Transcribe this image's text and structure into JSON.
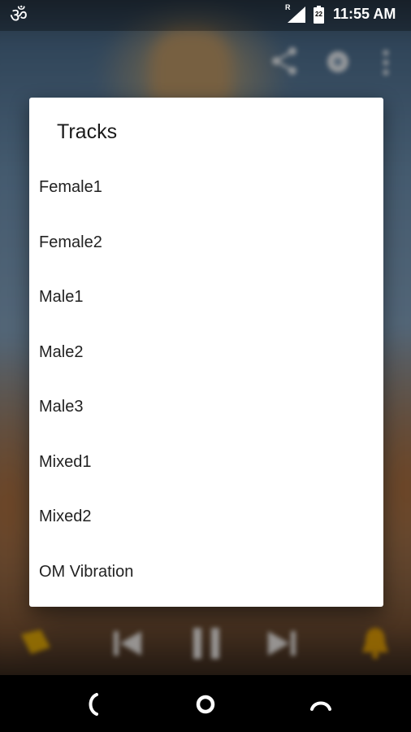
{
  "status_bar": {
    "app_icon": "om-icon",
    "roaming_indicator": "R",
    "battery_level": "22",
    "time": "11:55 AM"
  },
  "background_toolbar": {
    "icons": [
      "share-icon",
      "settings-icon",
      "more-vert-icon"
    ]
  },
  "dialog": {
    "title": "Tracks",
    "tracks": [
      "Female1",
      "Female2",
      "Male1",
      "Male2",
      "Male3",
      "Mixed1",
      "Mixed2",
      "OM Vibration"
    ]
  },
  "player_controls": {
    "icons": [
      "bookmark-icon",
      "previous-icon",
      "pause-icon",
      "next-icon",
      "bell-icon"
    ],
    "accent_color": "#f0b400"
  },
  "nav_bar": {
    "icons": [
      "back-icon",
      "home-icon",
      "recents-icon"
    ]
  }
}
